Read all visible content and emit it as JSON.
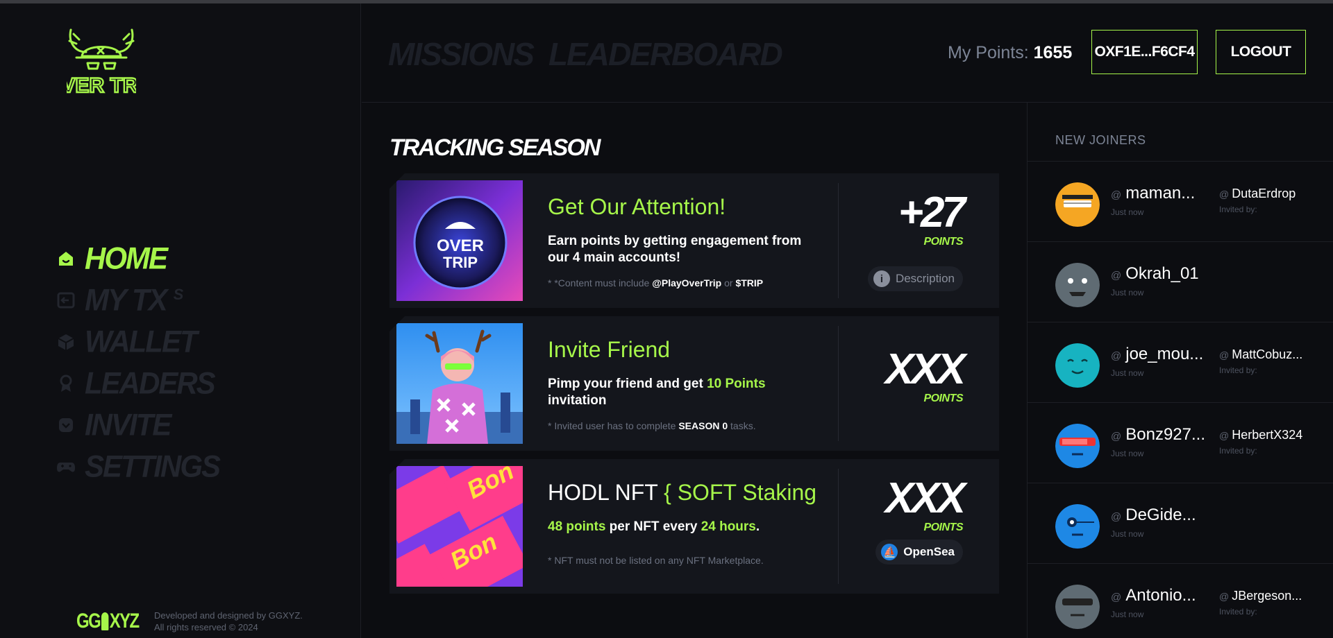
{
  "sidebar": {
    "logo_text": "OVER TRIP",
    "nav": [
      {
        "label": "HOME",
        "icon": "home-icon",
        "active": true
      },
      {
        "label": "MY TX",
        "suffix": "S",
        "icon": "tx-icon",
        "active": false
      },
      {
        "label": "WALLET",
        "icon": "cube-icon",
        "active": false
      },
      {
        "label": "LEADERS",
        "icon": "award-icon",
        "active": false
      },
      {
        "label": "INVITE",
        "icon": "invite-icon",
        "active": false
      },
      {
        "label": "SETTINGS",
        "icon": "gamepad-icon",
        "active": false
      }
    ],
    "footer": {
      "brand": "GGXYZ",
      "line1": "Developed and designed by GGXYZ.",
      "line2": "All rights reserved © 2024"
    }
  },
  "header": {
    "tabs": [
      "MISSIONS",
      "LEADERBOARD"
    ],
    "my_points_label": "My Points:",
    "my_points_value": "1655",
    "wallet_label": "OXF1E...F6CF4",
    "logout_label": "LOGOUT"
  },
  "main": {
    "section_title": "TRACKING SEASON",
    "missions": [
      {
        "title": "Get Our Attention!",
        "desc": "Earn points by getting engagement from our 4 main accounts!",
        "note_prefix": "* *Content must include ",
        "note_b1": "@PlayOverTrip",
        "note_mid": " or ",
        "note_b2": "$TRIP",
        "points": "+27",
        "points_label": "POINTS",
        "action": "Description"
      },
      {
        "title": "Invite Friend",
        "desc_prefix": "Pimp your friend and get ",
        "desc_green": "10 Points",
        "desc_suffix": " invitation",
        "note_prefix": "* Invited user has to complete ",
        "note_b1": "SEASON 0",
        "note_suffix": " tasks.",
        "points": "XXX",
        "points_label": "POINTS"
      },
      {
        "title_prefix": "HODL NFT ",
        "title_green": "{ SOFT Staking",
        "desc_green1": "48 points",
        "desc_mid": " per NFT every ",
        "desc_green2": "24 hours",
        "desc_end": ".",
        "note": "* NFT must not be listed on any NFT Marketplace.",
        "points": "XXX",
        "points_label": "POINTS",
        "action": "OpenSea"
      }
    ]
  },
  "joiners": {
    "title": "NEW JOINERS",
    "at": "@",
    "time": "Just now",
    "invited_label": "Invited by:",
    "users": [
      {
        "name": "maman...",
        "inviter": "DutaErdrop",
        "color": "#f5a623"
      },
      {
        "name": "Okrah_01",
        "inviter": "",
        "color": "#5f6b73"
      },
      {
        "name": "joe_mou...",
        "inviter": "MattCobuz...",
        "color": "#17b3c1"
      },
      {
        "name": "Bonz927...",
        "inviter": "HerbertX324",
        "color": "#1e88e5"
      },
      {
        "name": "DeGide...",
        "inviter": "",
        "color": "#1e88e5"
      },
      {
        "name": "Antonio...",
        "inviter": "JBergeson...",
        "color": "#5f6b73"
      }
    ]
  },
  "colors": {
    "accent": "#a6f64a",
    "bg": "#0c0d11",
    "card": "#14161c"
  }
}
